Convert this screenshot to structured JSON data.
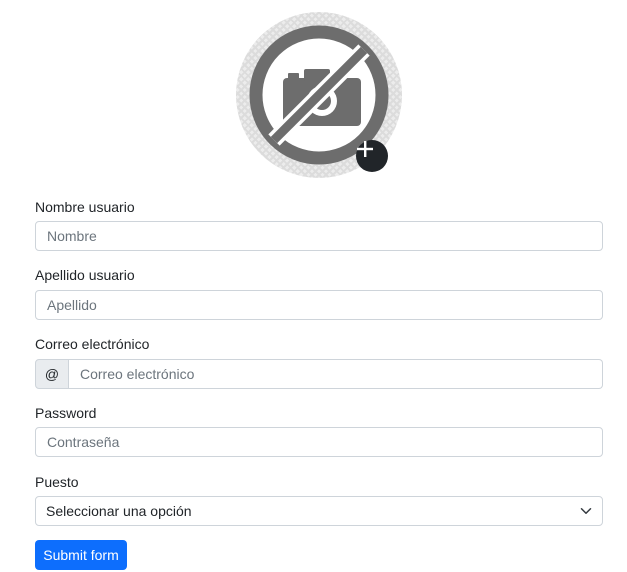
{
  "avatar": {
    "placeholder_icon": "no-camera-icon",
    "add_icon": "plus-icon"
  },
  "form": {
    "first_name": {
      "label": "Nombre usuario",
      "placeholder": "Nombre",
      "value": ""
    },
    "last_name": {
      "label": "Apellido usuario",
      "placeholder": "Apellido",
      "value": ""
    },
    "email": {
      "label": "Correo electrónico",
      "prefix": "@",
      "placeholder": "Correo electrónico",
      "value": ""
    },
    "password": {
      "label": "Password",
      "placeholder": "Contraseña",
      "value": ""
    },
    "position": {
      "label": "Puesto",
      "selected": "Seleccionar una opción",
      "icon": "chevron-down-icon"
    },
    "submit_label": "Submit form"
  },
  "colors": {
    "primary": "#0d6efd",
    "dark": "#212529",
    "border": "#ced4da",
    "addon_bg": "#e9ecef",
    "icon_gray": "#6d6d6d"
  }
}
